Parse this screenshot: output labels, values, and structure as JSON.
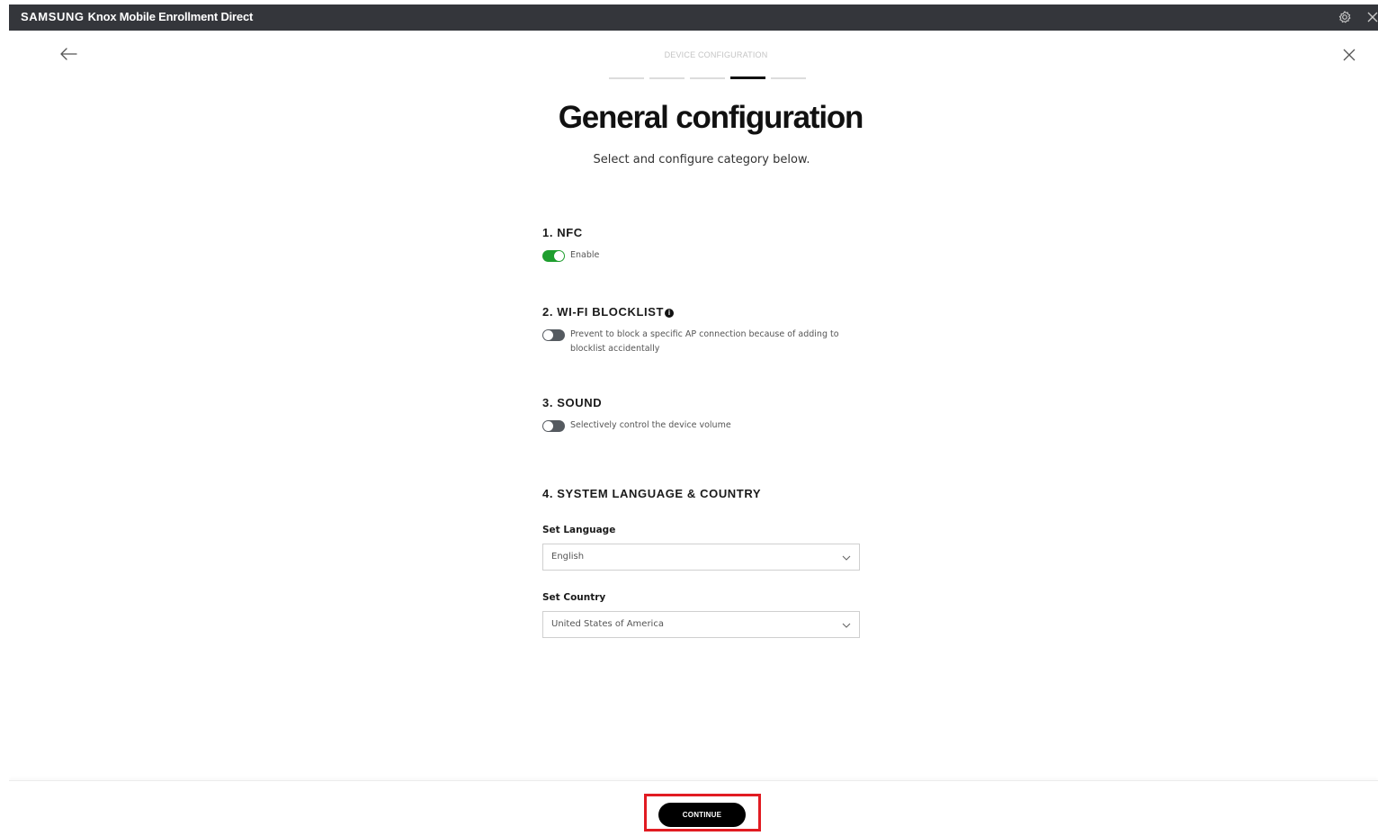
{
  "titlebar": {
    "brand": "SAMSUNG",
    "title": "Knox Mobile Enrollment Direct",
    "icons": [
      "gear-icon",
      "close-icon"
    ]
  },
  "header": {
    "step_label": "DEVICE CONFIGURATION",
    "steps_total": 5,
    "active_step": 4
  },
  "main": {
    "title": "General configuration",
    "subtitle": "Select and configure category below.",
    "sections": [
      {
        "heading": "1. NFC",
        "toggle_on": true,
        "toggle_label": "Enable"
      },
      {
        "heading": "2. WI-FI BLOCKLIST",
        "info": "i",
        "toggle_on": false,
        "toggle_label": "Prevent to block a specific AP connection because of adding to blocklist accidentally"
      },
      {
        "heading": "3. SOUND",
        "toggle_on": false,
        "toggle_label": "Selectively control the device volume"
      },
      {
        "heading": "4. SYSTEM LANGUAGE & COUNTRY"
      }
    ],
    "language": {
      "label": "Set Language",
      "value": "English"
    },
    "country": {
      "label": "Set Country",
      "value": "United States of America"
    }
  },
  "footer": {
    "continue_label": "CONTINUE"
  },
  "colors": {
    "titlebar_bg": "#34363b",
    "toggle_on": "#1e9e2e",
    "toggle_off": "#555a60",
    "highlight": "#e11b22",
    "button_bg": "#000000"
  }
}
